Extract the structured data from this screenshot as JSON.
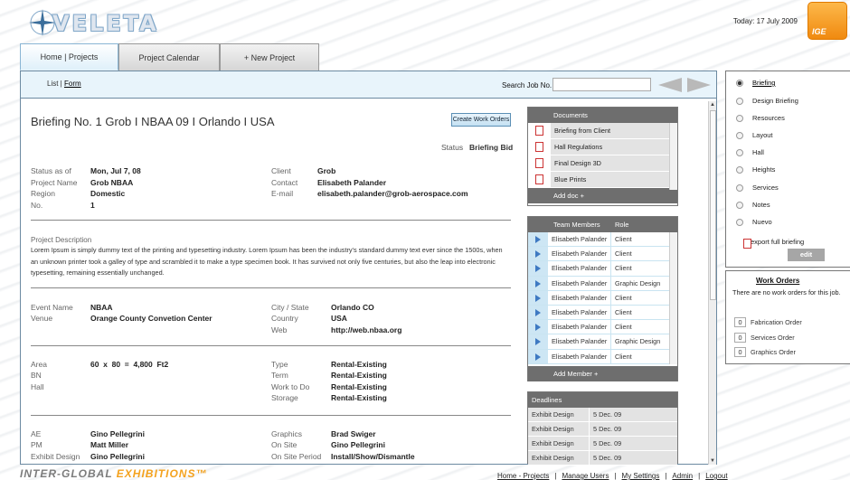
{
  "header": {
    "logo_text": "VELETA",
    "today": "Today: 17 July 2009",
    "ige_badge": "IGE"
  },
  "tabs": [
    "Home | Projects",
    "Project Calendar",
    "+ New Project"
  ],
  "toolbar": {
    "list": "List",
    "sep": " | ",
    "form": "Form",
    "search_label": "Search Job No. :",
    "search_value": ""
  },
  "brief": {
    "title": "Briefing No. 1 Grob I NBAA 09 I Orlando I USA",
    "create_wo": "Create Work Orders",
    "status_label": "Status",
    "status_value": "Briefing Bid",
    "status_as_of_label": "Status as of",
    "status_as_of": "Mon, Jul 7, 08",
    "project_name_label": "Project Name",
    "project_name": "Grob NBAA",
    "region_label": "Region",
    "region": "Domestic",
    "no_label": "No.",
    "no": "1",
    "client_label": "Client",
    "client": "Grob",
    "contact_label": "Contact",
    "contact": "Elisabeth Palander",
    "email_label": "E-mail",
    "email": "elisabeth.palander@grob-aerospace.com",
    "desc_label": "Project Description",
    "description": "Lorem Ipsum is simply dummy text of the printing and typesetting industry. Lorem Ipsum has been the industry's standard dummy text ever since the 1500s, when an unknown printer took a galley of type and scrambled it to make a type specimen book. It has survived not only five centuries, but also the leap into electronic typesetting, remaining essentially unchanged.",
    "event_name_label": "Event Name",
    "event_name": "NBAA",
    "venue_label": "Venue",
    "venue": "Orange County Convetion Center",
    "city_label": "City / State",
    "city": "Orlando  CO",
    "country_label": "Country",
    "country": "USA",
    "web_label": "Web",
    "web": "http://web.nbaa.org",
    "area_label": "Area",
    "area": "60  x  80  =  4,800  Ft2",
    "bn_label": "BN",
    "hall_label": "Hall",
    "type_label": "Type",
    "type": "Rental-Existing",
    "term_label": "Term",
    "term": "Rental-Existing",
    "work_label": "Work to Do",
    "work": "Rental-Existing",
    "storage_label": "Storage",
    "storage": "Rental-Existing",
    "ae_label": "AE",
    "ae": "Gino Pellegrini",
    "pm_label": "PM",
    "pm": "Matt Miller",
    "exhibit_label": "Exhibit Design",
    "exhibit": "Gino Pellegrini",
    "graphics_label": "Graphics",
    "graphics": "Brad Swiger",
    "onsite_label": "On Site",
    "onsite": "Gino Pellegrini",
    "onsite_period_label": "On Site Period",
    "onsite_period": "Install/Show/Dismantle"
  },
  "documents": {
    "header": "Documents",
    "items": [
      "Briefing from Client",
      "Hall Regulations",
      "Final Design 3D",
      "Blue Prints"
    ],
    "footer": "Add doc +"
  },
  "team": {
    "col1": "Team Members",
    "col2": "Role",
    "footer": "Add Member +",
    "rows": [
      [
        "Elisabeth Palander",
        "Client"
      ],
      [
        "Elisabeth Palander",
        "Client"
      ],
      [
        "Elisabeth Palander",
        "Client"
      ],
      [
        "Elisabeth Palander",
        "Graphic Design"
      ],
      [
        "Elisabeth Palander",
        "Client"
      ],
      [
        "Elisabeth Palander",
        "Client"
      ],
      [
        "Elisabeth Palander",
        "Client"
      ],
      [
        "Elisabeth Palander",
        "Graphic Design"
      ],
      [
        "Elisabeth Palander",
        "Client"
      ]
    ]
  },
  "deadlines": {
    "header": "Deadlines",
    "rows": [
      [
        "Exhibit Design",
        "5 Dec. 09"
      ],
      [
        "Exhibit Design",
        "5 Dec. 09"
      ],
      [
        "Exhibit Design",
        "5 Dec. 09"
      ],
      [
        "Exhibit Design",
        "5 Dec. 09"
      ]
    ]
  },
  "side_menu": {
    "items": [
      "Briefing",
      "Design Briefing",
      "Resources",
      "Layout",
      "Hall",
      "Heights",
      "Services",
      "Notes",
      "Nuevo"
    ],
    "export": "export full briefing",
    "edit": "edit"
  },
  "work_orders": {
    "title": "Work Orders",
    "note": "There are no work orders for this job.",
    "rows": [
      [
        "0",
        "Fabrication Order"
      ],
      [
        "0",
        "Services Order"
      ],
      [
        "0",
        "Graphics Order"
      ]
    ]
  },
  "footer": {
    "brand_a": "INTER-GLOBAL ",
    "brand_b": "EXHIBITIONS™",
    "nav": [
      "Home - Projects",
      "Manage Users",
      "My Settings",
      "Admin",
      "Logout"
    ]
  }
}
